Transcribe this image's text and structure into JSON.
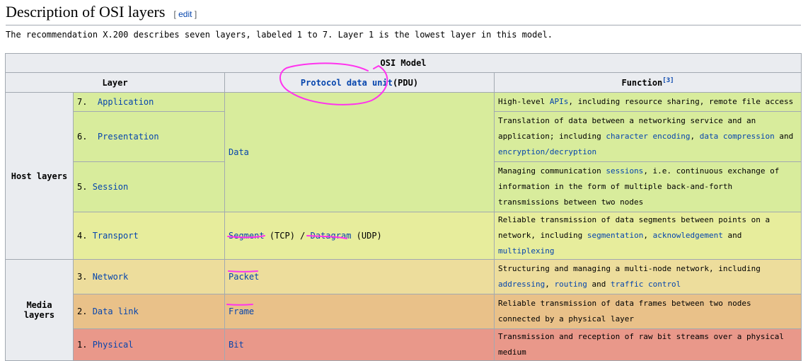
{
  "heading": {
    "title": "Description of OSI layers",
    "edit": "edit"
  },
  "intro": "The recommendation X.200 describes seven layers, labeled 1 to 7. Layer 1 is the lowest layer in this model.",
  "table": {
    "caption": "OSI Model",
    "headers": {
      "layer": "Layer",
      "pdu_link": "Protocol data unit",
      "pdu_suffix": "(PDU)",
      "function": "Function",
      "function_ref": "[3]"
    },
    "groups": {
      "host": "Host layers",
      "media": "Media layers"
    },
    "rows": [
      {
        "num": "7.",
        "name": "Application",
        "func": [
          "High-level ",
          {
            "l": "APIs"
          },
          ", including resource sharing, remote file access"
        ]
      },
      {
        "num": "6.",
        "name": "Presentation",
        "func": [
          "Translation of data between a networking service and an application; including ",
          {
            "l": "character encoding"
          },
          ", ",
          {
            "l": "data compression"
          },
          " and ",
          {
            "l": "encryption/decryption"
          }
        ]
      },
      {
        "num": "5.",
        "name": "Session",
        "func": [
          "Managing communication ",
          {
            "l": "sessions"
          },
          ", i.e. continuous exchange of information in the form of multiple back-and-forth transmissions between two nodes"
        ]
      },
      {
        "num": "4.",
        "name": "Transport",
        "func": [
          "Reliable transmission of data segments between points on a network, including ",
          {
            "l": "segmentation"
          },
          ", ",
          {
            "l": "acknowledgement"
          },
          " and ",
          {
            "l": "multiplexing"
          }
        ]
      },
      {
        "num": "3.",
        "name": "Network",
        "func": [
          "Structuring and managing a multi-node network, including ",
          {
            "l": "addressing"
          },
          ", ",
          {
            "l": "routing"
          },
          " and ",
          {
            "l": "traffic control"
          }
        ]
      },
      {
        "num": "2.",
        "name": "Data link",
        "func": [
          "Reliable transmission of data frames between two nodes connected by a physical layer"
        ]
      },
      {
        "num": "1.",
        "name": "Physical",
        "func": [
          "Transmission and reception of raw bit streams over a physical medium"
        ]
      }
    ],
    "pdu": {
      "data": "Data",
      "segment": "Segment",
      "tcp": "(TCP) /",
      "datagram": "Datagram",
      "udp": "(UDP)",
      "packet": "Packet",
      "frame": "Frame",
      "bit": "Bit"
    }
  },
  "colors": {
    "host_upper": "#d8ec9c",
    "transport": "#e7ed9c",
    "network": "#eddd9c",
    "datalink": "#e9c189",
    "physical": "#e9988a",
    "annotation": "#ff33ee",
    "link": "#0645ad"
  }
}
